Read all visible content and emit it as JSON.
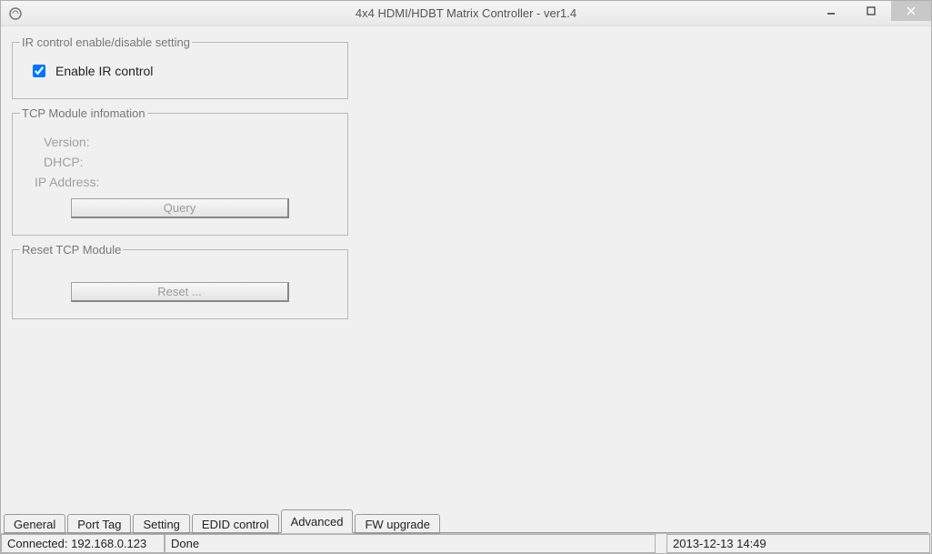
{
  "window": {
    "title": "4x4 HDMI/HDBT Matrix Controller - ver1.4"
  },
  "ir_group": {
    "legend": "IR control enable/disable setting",
    "checkbox_label": "Enable IR control",
    "checked": true
  },
  "tcp_info_group": {
    "legend": "TCP Module infomation",
    "version_label": "Version:",
    "dhcp_label": "DHCP:",
    "ip_label": "IP Address:",
    "query_btn": "Query"
  },
  "reset_group": {
    "legend": "Reset TCP Module",
    "reset_btn": "Reset ..."
  },
  "tabs": [
    {
      "label": "General"
    },
    {
      "label": "Port Tag"
    },
    {
      "label": "Setting"
    },
    {
      "label": "EDID control"
    },
    {
      "label": "Advanced",
      "active": true
    },
    {
      "label": "FW upgrade"
    }
  ],
  "status": {
    "connection": "Connected: 192.168.0.123",
    "message": "Done",
    "datetime": "2013-12-13 14:49"
  }
}
